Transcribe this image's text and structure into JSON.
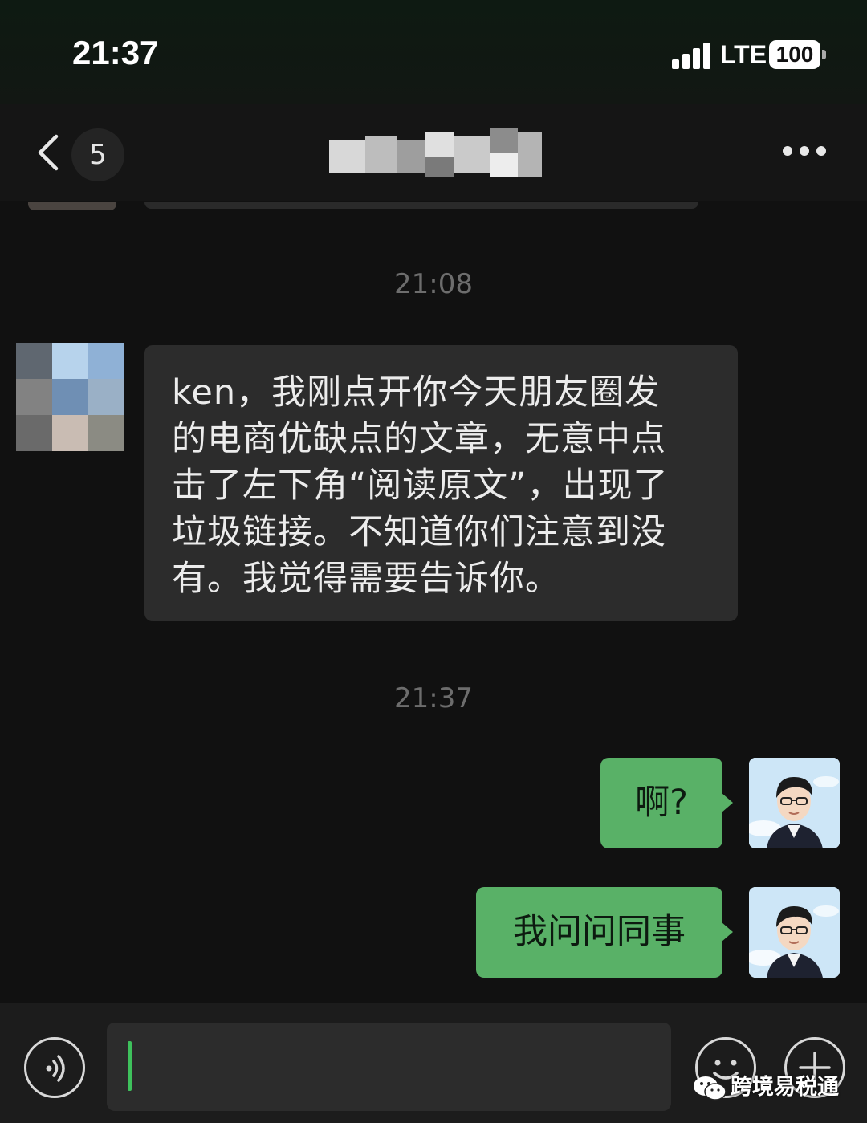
{
  "status_bar": {
    "time": "21:37",
    "network": "LTE",
    "battery": "100"
  },
  "nav": {
    "back_icon": "chevron-left-icon",
    "unread_count": "5",
    "title_obscured": true,
    "more_icon": "ellipsis-icon"
  },
  "messages": [
    {
      "type": "timestamp",
      "text": "21:08"
    },
    {
      "type": "received",
      "avatar_obscured": true,
      "lines": [
        "ken，我刚点开你今天朋友圈发",
        "的电商优缺点的文章，无意中点",
        "击了左下角“阅读原文”，出现了",
        "垃圾链接。不知道你们注意到没",
        "有。我觉得需要告诉你。"
      ]
    },
    {
      "type": "timestamp",
      "text": "21:37"
    },
    {
      "type": "sent",
      "text": "啊?"
    },
    {
      "type": "sent",
      "text": "我问问同事"
    }
  ],
  "input_bar": {
    "voice_icon": "voice-icon",
    "emoji_icon": "emoji-icon",
    "plus_icon": "plus-icon",
    "input_value": ""
  },
  "watermark": {
    "icon": "wechat-icon",
    "text": "跨境易税通"
  },
  "colors": {
    "background": "#111111",
    "received_bubble": "#2c2c2c",
    "sent_bubble": "#59b167",
    "caret": "#3ec15c"
  }
}
